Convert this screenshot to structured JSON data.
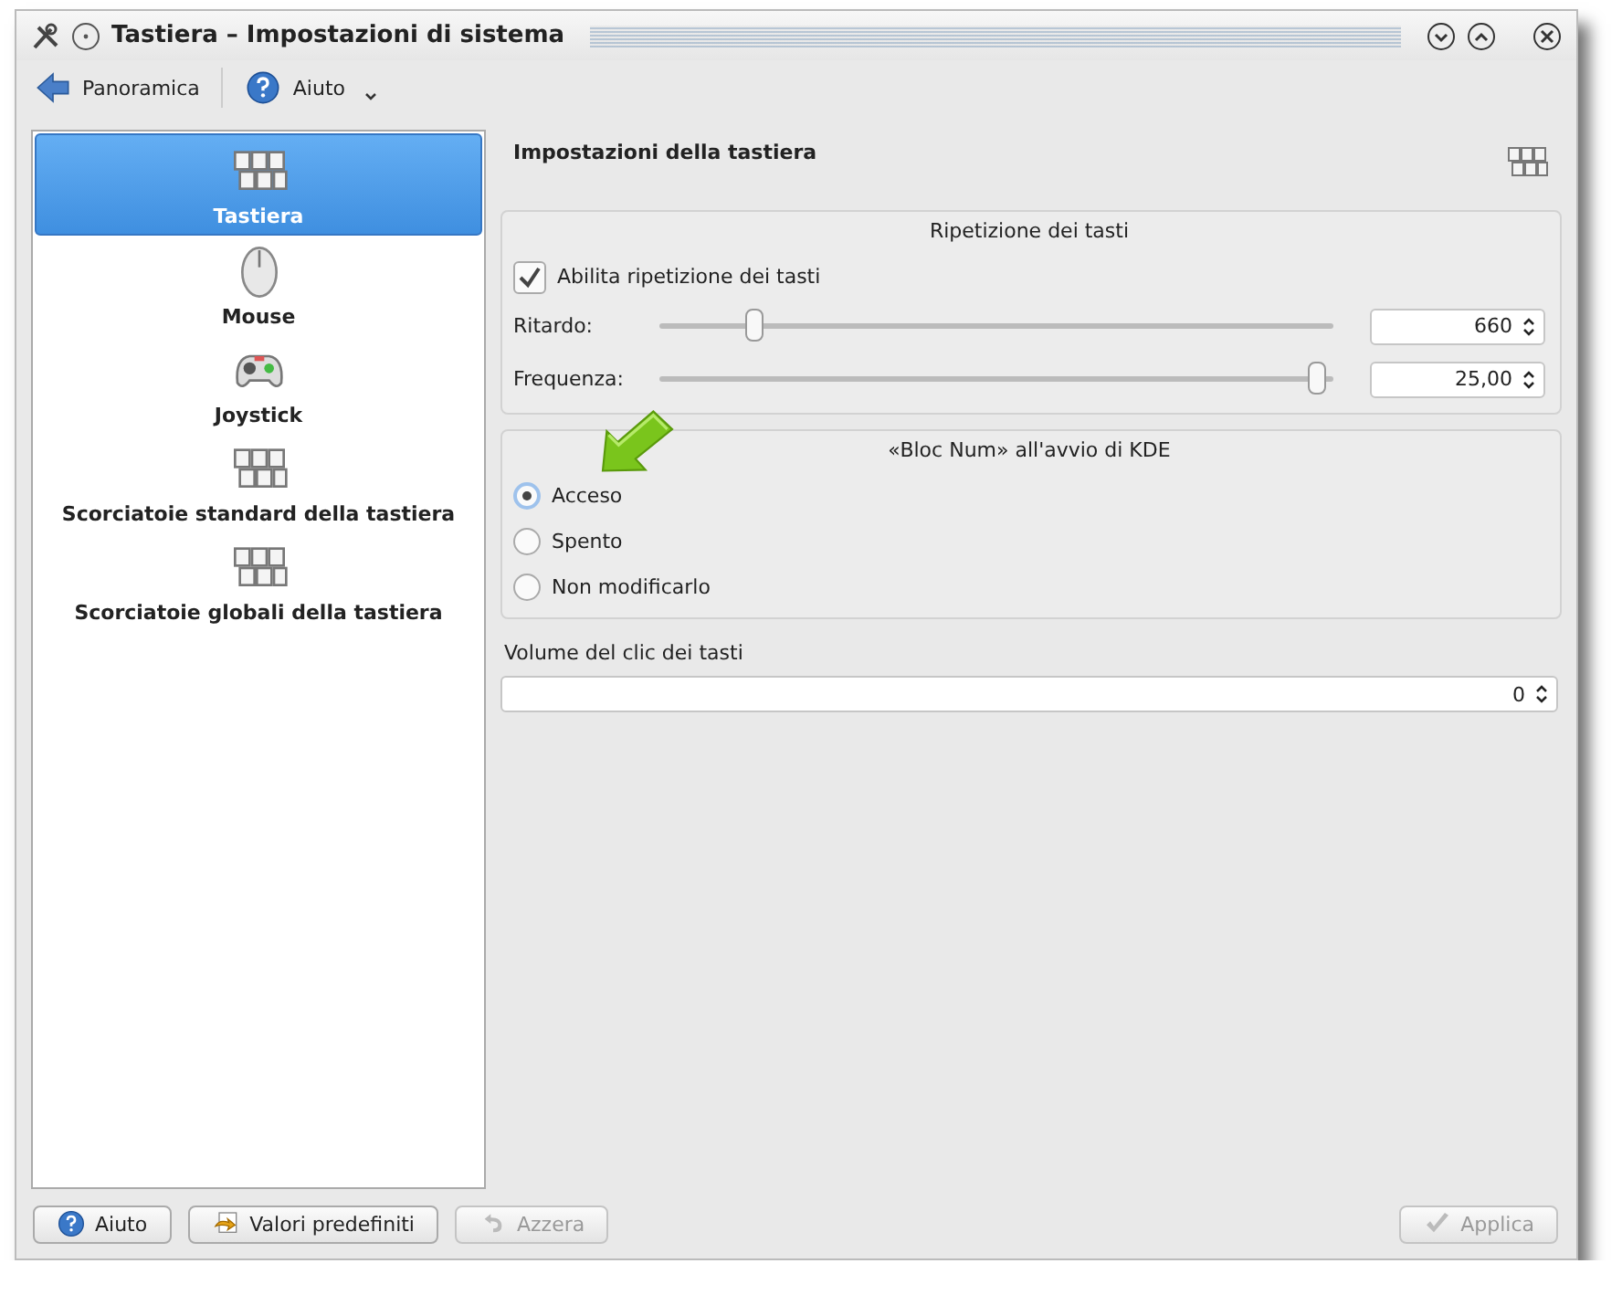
{
  "window": {
    "title": "Tastiera – Impostazioni di sistema"
  },
  "toolbar": [
    {
      "kind": "back",
      "label": "Panoramica"
    },
    {
      "kind": "help",
      "label": "Aiuto"
    }
  ],
  "sidebar": {
    "items": [
      {
        "kind": "keyboard",
        "label": "Tastiera",
        "selected": true
      },
      {
        "kind": "mouse",
        "label": "Mouse",
        "selected": false
      },
      {
        "kind": "joystick",
        "label": "Joystick",
        "selected": false
      },
      {
        "kind": "keyboard",
        "label": "Scorciatoie standard della tastiera",
        "selected": false
      },
      {
        "kind": "keyboard",
        "label": "Scorciatoie globali della tastiera",
        "selected": false
      }
    ]
  },
  "page_title": "Impostazioni della tastiera",
  "repeat_group": {
    "title": "Ripetizione dei tasti",
    "checkbox": {
      "label": "Abilita ripetizione dei tasti",
      "checked": true
    },
    "sliders": [
      {
        "label": "Ritardo:",
        "level": 0.13,
        "value": "660"
      },
      {
        "label": "Frequenza:",
        "level": 0.99,
        "value": "25,00"
      }
    ]
  },
  "numlock_group": {
    "title": "«Bloc Num» all'avvio di KDE",
    "options": [
      {
        "label": "Acceso",
        "selected": true
      },
      {
        "label": "Spento",
        "selected": false
      },
      {
        "label": "Non modificarlo",
        "selected": false
      }
    ]
  },
  "volume": {
    "label": "Volume del clic dei tasti",
    "value": "0"
  },
  "buttons": [
    {
      "kind": "help",
      "label": "Aiuto",
      "disabled": false
    },
    {
      "kind": "defaults",
      "label": "Valori predefiniti",
      "disabled": false
    },
    {
      "kind": "reset",
      "label": "Azzera",
      "disabled": true
    },
    {
      "kind": "apply",
      "label": "Applica",
      "disabled": true
    }
  ]
}
